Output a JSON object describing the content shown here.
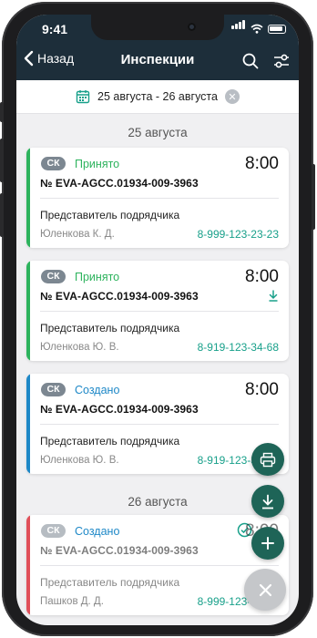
{
  "status_bar": {
    "time": "9:41"
  },
  "header": {
    "back_label": "Назад",
    "title": "Инспекции"
  },
  "date_filter": {
    "label": "25 августа - 26 августа"
  },
  "sections": [
    {
      "date": "25 августа"
    },
    {
      "date": "26 августа"
    }
  ],
  "cards": [
    {
      "type": "СК",
      "status": "Принято",
      "time": "8:00",
      "number": "№ EVA-AGCC.01934-009-3963",
      "rep_label": "Представитель подрядчика",
      "rep_name": "Юленкова К. Д.",
      "phone": "8-999-123-23-23"
    },
    {
      "type": "СК",
      "status": "Принято",
      "time": "8:00",
      "number": "№ EVA-AGCC.01934-009-3963",
      "rep_label": "Представитель подрядчика",
      "rep_name": "Юленкова Ю. В.",
      "phone": "8-919-123-34-68"
    },
    {
      "type": "СК",
      "status": "Создано",
      "time": "8:00",
      "number": "№ EVA-AGCC.01934-009-3963",
      "rep_label": "Представитель подрядчика",
      "rep_name": "Юленкова Ю. В.",
      "phone": "8-919-123-34-68"
    },
    {
      "type": "СК",
      "status": "Создано",
      "time": "8:00",
      "number": "№ EVA-AGCC.01934-009-3963",
      "rep_label": "Представитель подрядчика",
      "rep_name": "Пашков Д. Д.",
      "phone": "8-999-123-23-23"
    }
  ],
  "colors": {
    "header_bg": "#1d2e3a",
    "accent_green": "#18a08a",
    "status_accepted": "#2db35d",
    "status_created": "#1e88c7",
    "stripe_green": "#2db35d",
    "stripe_blue": "#1e88c7",
    "stripe_red": "#e0505a",
    "fab_dark": "#1e6457",
    "fab_close": "#c5c7ca"
  },
  "icons": [
    "back-chevron-icon",
    "search-icon",
    "filter-icon",
    "calendar-icon",
    "clear-icon",
    "download-icon",
    "check-circle-icon",
    "print-icon",
    "plus-icon",
    "close-icon"
  ]
}
